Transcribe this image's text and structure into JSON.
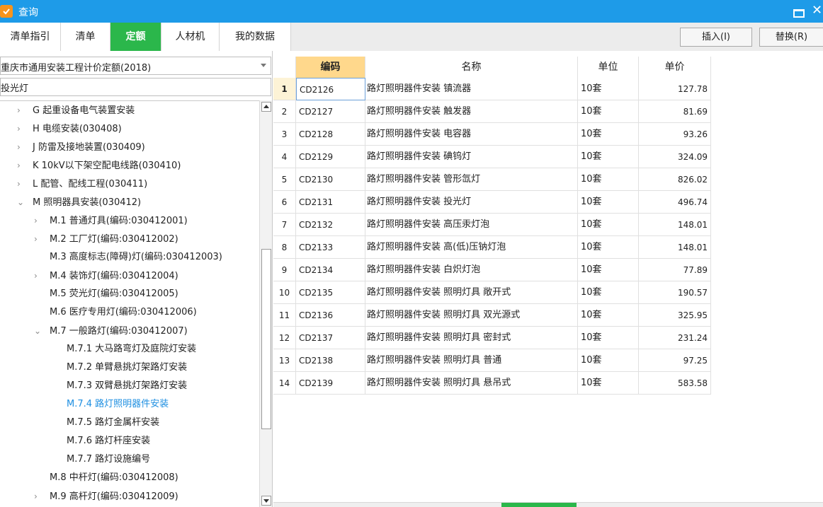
{
  "window": {
    "title": "查询",
    "close_glyph": "✕"
  },
  "tabs": [
    {
      "label": "清单指引"
    },
    {
      "label": "清单"
    },
    {
      "label": "定额"
    },
    {
      "label": "人材机"
    },
    {
      "label": "我的数据"
    }
  ],
  "actions": {
    "insert_label": "插入(I)",
    "replace_label": "替换(R)"
  },
  "left_panel": {
    "library": "重庆市通用安装工程计价定额(2018)",
    "search_value": "投光灯"
  },
  "tree": [
    {
      "text": "G 起重设备电气装置安装",
      "chev": "›"
    },
    {
      "text": "H 电缆安装(030408)",
      "chev": "›"
    },
    {
      "text": "J 防雷及接地装置(030409)",
      "chev": "›"
    },
    {
      "text": "K 10kV以下架空配电线路(030410)",
      "chev": "›"
    },
    {
      "text": "L 配管、配线工程(030411)",
      "chev": "›"
    },
    {
      "text": "M 照明器具安装(030412)",
      "chev": "⌄"
    },
    {
      "text": "M.1 普通灯具(编码:030412001)",
      "chev": "›"
    },
    {
      "text": "M.2 工厂灯(编码:030412002)",
      "chev": "›"
    },
    {
      "text": "M.3 高度标志(障碍)灯(编码:030412003)",
      "chev": ""
    },
    {
      "text": "M.4 装饰灯(编码:030412004)",
      "chev": "›"
    },
    {
      "text": "M.5 荧光灯(编码:030412005)",
      "chev": ""
    },
    {
      "text": "M.6 医疗专用灯(编码:030412006)",
      "chev": ""
    },
    {
      "text": "M.7 一般路灯(编码:030412007)",
      "chev": "⌄"
    },
    {
      "text": "M.7.1 大马路弯灯及庭院灯安装",
      "chev": ""
    },
    {
      "text": "M.7.2 单臂悬挑灯架路灯安装",
      "chev": ""
    },
    {
      "text": "M.7.3 双臂悬挑灯架路灯安装",
      "chev": ""
    },
    {
      "text": "M.7.4 路灯照明器件安装",
      "chev": ""
    },
    {
      "text": "M.7.5 路灯金属杆安装",
      "chev": ""
    },
    {
      "text": "M.7.6 路灯杆座安装",
      "chev": ""
    },
    {
      "text": "M.7.7 路灯设施编号",
      "chev": ""
    },
    {
      "text": "M.8 中杆灯(编码:030412008)",
      "chev": ""
    },
    {
      "text": "M.9 高杆灯(编码:030412009)",
      "chev": "›"
    }
  ],
  "table": {
    "headers": {
      "code": "编码",
      "name": "名称",
      "unit": "单位",
      "price": "单价"
    },
    "rows": [
      {
        "idx": "1",
        "code": "CD2126",
        "name": "路灯照明器件安装 镇流器",
        "unit": "10套",
        "price": "127.78"
      },
      {
        "idx": "2",
        "code": "CD2127",
        "name": "路灯照明器件安装 触发器",
        "unit": "10套",
        "price": "81.69"
      },
      {
        "idx": "3",
        "code": "CD2128",
        "name": "路灯照明器件安装 电容器",
        "unit": "10套",
        "price": "93.26"
      },
      {
        "idx": "4",
        "code": "CD2129",
        "name": "路灯照明器件安装 碘钨灯",
        "unit": "10套",
        "price": "324.09"
      },
      {
        "idx": "5",
        "code": "CD2130",
        "name": "路灯照明器件安装 管形氙灯",
        "unit": "10套",
        "price": "826.02"
      },
      {
        "idx": "6",
        "code": "CD2131",
        "name": "路灯照明器件安装 投光灯",
        "unit": "10套",
        "price": "496.74"
      },
      {
        "idx": "7",
        "code": "CD2132",
        "name": "路灯照明器件安装 高压汞灯泡",
        "unit": "10套",
        "price": "148.01"
      },
      {
        "idx": "8",
        "code": "CD2133",
        "name": "路灯照明器件安装 高(低)压钠灯泡",
        "unit": "10套",
        "price": "148.01"
      },
      {
        "idx": "9",
        "code": "CD2134",
        "name": "路灯照明器件安装 白炽灯泡",
        "unit": "10套",
        "price": "77.89"
      },
      {
        "idx": "10",
        "code": "CD2135",
        "name": "路灯照明器件安装 照明灯具 敞开式",
        "unit": "10套",
        "price": "190.57"
      },
      {
        "idx": "11",
        "code": "CD2136",
        "name": "路灯照明器件安装 照明灯具 双光源式",
        "unit": "10套",
        "price": "325.95"
      },
      {
        "idx": "12",
        "code": "CD2137",
        "name": "路灯照明器件安装 照明灯具 密封式",
        "unit": "10套",
        "price": "231.24"
      },
      {
        "idx": "13",
        "code": "CD2138",
        "name": "路灯照明器件安装 照明灯具 普通",
        "unit": "10套",
        "price": "97.25"
      },
      {
        "idx": "14",
        "code": "CD2139",
        "name": "路灯照明器件安装 照明灯具 悬吊式",
        "unit": "10套",
        "price": "583.58"
      }
    ]
  },
  "icons": {
    "app": "app-icon",
    "minimize": "minimize-icon",
    "close": "close-icon",
    "dropdown": "chevron-down-icon"
  },
  "colors": {
    "titlebar": "#1e9be8",
    "active_tab": "#2bb74b",
    "selected_tree": "#1e8fe1",
    "header_highlight": "#ffd88c"
  }
}
